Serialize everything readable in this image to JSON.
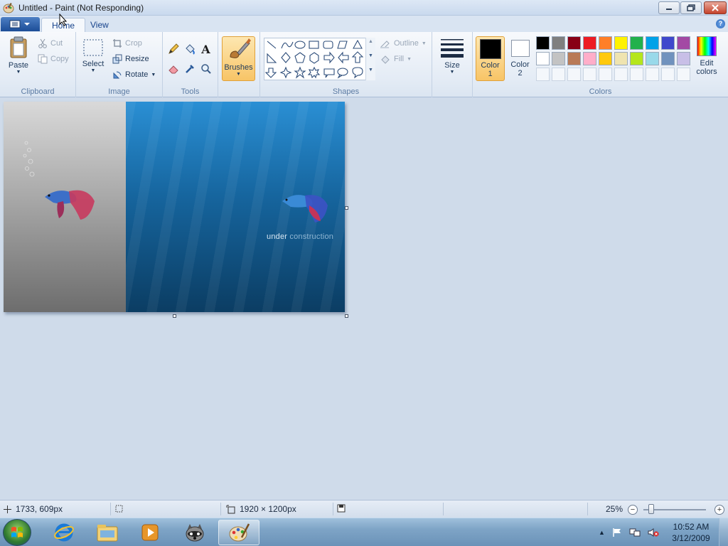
{
  "window": {
    "title": "Untitled - Paint (Not Responding)",
    "icon": "paint-palette-icon",
    "buttons": [
      "minimize-icon",
      "maximize-icon",
      "close-icon"
    ]
  },
  "ribbon_tabs": {
    "home": "Home",
    "view": "View"
  },
  "clipboard": {
    "group_label": "Clipboard",
    "paste": "Paste",
    "cut": "Cut",
    "copy": "Copy"
  },
  "image_group": {
    "group_label": "Image",
    "select": "Select",
    "crop": "Crop",
    "resize": "Resize",
    "rotate": "Rotate"
  },
  "tools": {
    "group_label": "Tools",
    "items": [
      "pencil-icon",
      "fill-bucket-icon",
      "text-icon",
      "eraser-icon",
      "color-picker-icon",
      "magnifier-icon"
    ],
    "text_glyph": "A"
  },
  "brushes": {
    "label": "Brushes"
  },
  "shapes": {
    "group_label": "Shapes",
    "outline": "Outline",
    "fill": "Fill"
  },
  "size": {
    "label": "Size"
  },
  "colors": {
    "group_label": "Colors",
    "color1_label_1": "Color",
    "color1_label_2": "1",
    "color2_label_1": "Color",
    "color2_label_2": "2",
    "color1_value": "#000000",
    "color2_value": "#ffffff",
    "edit_1": "Edit",
    "edit_2": "colors",
    "row1": [
      "#000000",
      "#7f7f7f",
      "#880015",
      "#ed1c24",
      "#ff7f27",
      "#fff200",
      "#22b14c",
      "#00a2e8",
      "#3f48cc",
      "#a349a4"
    ],
    "row2": [
      "#ffffff",
      "#c3c3c3",
      "#b97a57",
      "#ffaec9",
      "#ffc90e",
      "#efe4b0",
      "#b5e61d",
      "#99d9ea",
      "#7092be",
      "#c8bfe7"
    ]
  },
  "canvas": {
    "caption_prefix": "under",
    "caption_rest": " construction"
  },
  "status": {
    "cursor_pos": "1733, 609px",
    "image_size": "1920 × 1200px",
    "zoom": "25%"
  },
  "taskbar": {
    "items": [
      "internet-explorer-icon",
      "windows-explorer-icon",
      "media-player-icon",
      "raccoon-app-icon",
      "paint-icon"
    ],
    "time": "10:52 AM",
    "date": "3/12/2009"
  }
}
